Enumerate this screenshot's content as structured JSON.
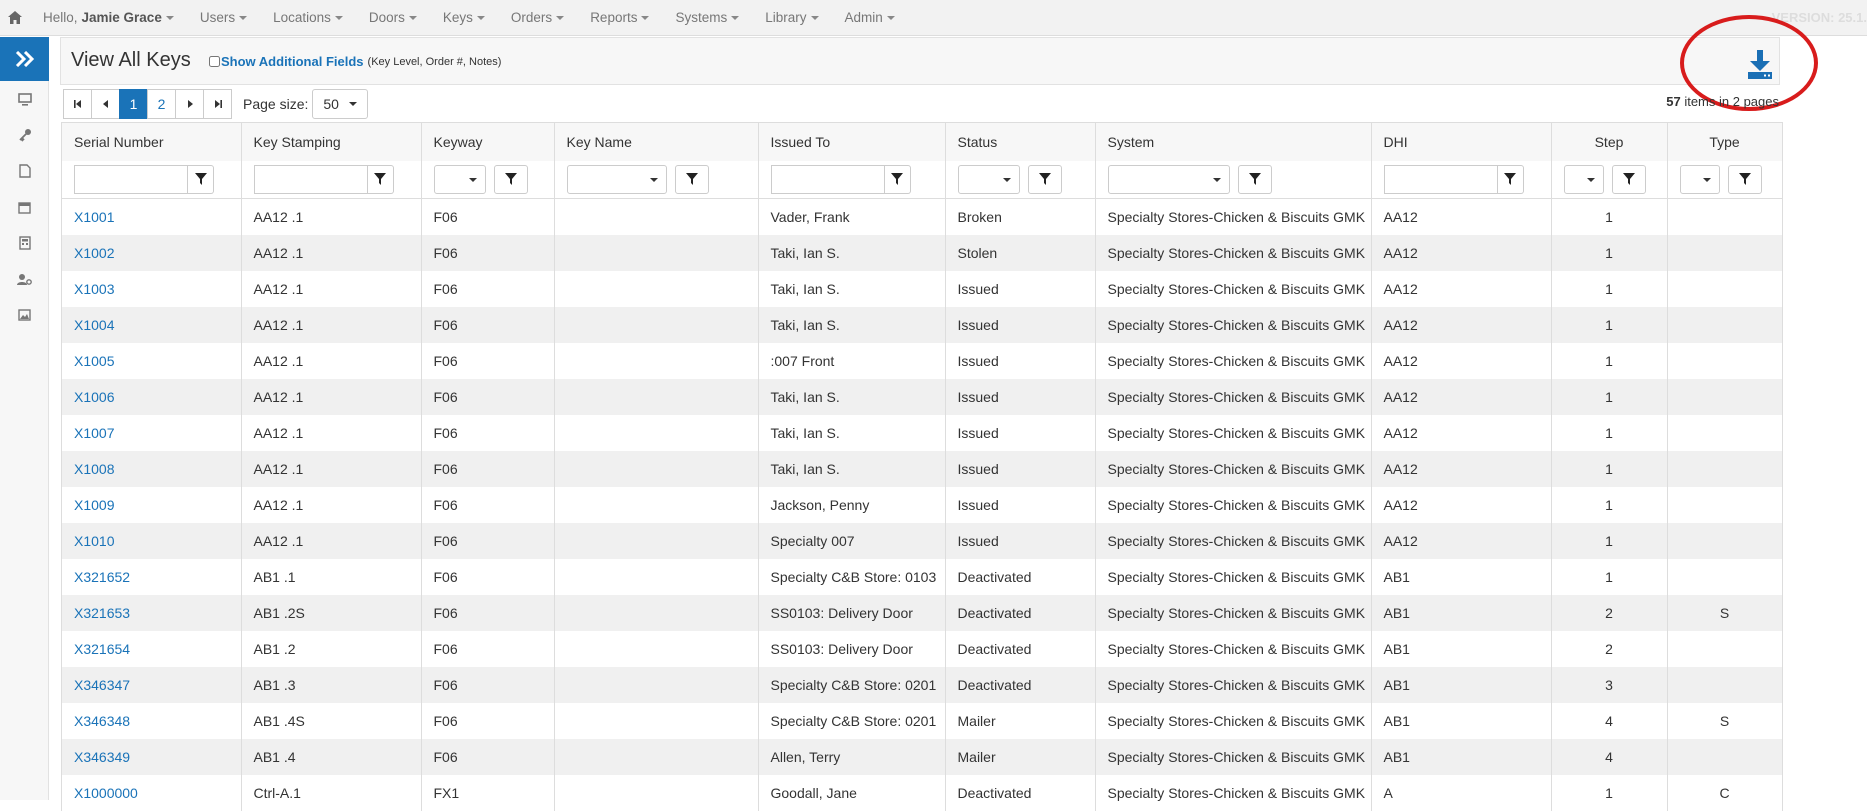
{
  "nav": {
    "greeting": "Hello,",
    "user": "Jamie Grace",
    "items": [
      "Users",
      "Locations",
      "Doors",
      "Keys",
      "Orders",
      "Reports",
      "Systems",
      "Library",
      "Admin"
    ],
    "version": "VERSION: 25.1."
  },
  "page": {
    "title": "View All Keys",
    "show_fields_label": "Show Additional Fields",
    "show_fields_hint": "(Key Level, Order #, Notes)"
  },
  "pager": {
    "pages": [
      "1",
      "2"
    ],
    "page_size_label": "Page size:",
    "page_size": "50",
    "items_count": "57",
    "items_text": "items in 2 pages"
  },
  "columns": [
    "Serial Number",
    "Key Stamping",
    "Keyway",
    "Key Name",
    "Issued To",
    "Status",
    "System",
    "DHI",
    "Step",
    "Type"
  ],
  "rows": [
    [
      "X1001",
      "AA12 .1",
      "F06",
      "",
      "Vader, Frank",
      "Broken",
      "Specialty Stores-Chicken & Biscuits GMK",
      "AA12",
      "1",
      ""
    ],
    [
      "X1002",
      "AA12 .1",
      "F06",
      "",
      "Taki, Ian S.",
      "Stolen",
      "Specialty Stores-Chicken & Biscuits GMK",
      "AA12",
      "1",
      ""
    ],
    [
      "X1003",
      "AA12 .1",
      "F06",
      "",
      "Taki, Ian S.",
      "Issued",
      "Specialty Stores-Chicken & Biscuits GMK",
      "AA12",
      "1",
      ""
    ],
    [
      "X1004",
      "AA12 .1",
      "F06",
      "",
      "Taki, Ian S.",
      "Issued",
      "Specialty Stores-Chicken & Biscuits GMK",
      "AA12",
      "1",
      ""
    ],
    [
      "X1005",
      "AA12 .1",
      "F06",
      "",
      ":007 Front",
      "Issued",
      "Specialty Stores-Chicken & Biscuits GMK",
      "AA12",
      "1",
      ""
    ],
    [
      "X1006",
      "AA12 .1",
      "F06",
      "",
      "Taki, Ian S.",
      "Issued",
      "Specialty Stores-Chicken & Biscuits GMK",
      "AA12",
      "1",
      ""
    ],
    [
      "X1007",
      "AA12 .1",
      "F06",
      "",
      "Taki, Ian S.",
      "Issued",
      "Specialty Stores-Chicken & Biscuits GMK",
      "AA12",
      "1",
      ""
    ],
    [
      "X1008",
      "AA12 .1",
      "F06",
      "",
      "Taki, Ian S.",
      "Issued",
      "Specialty Stores-Chicken & Biscuits GMK",
      "AA12",
      "1",
      ""
    ],
    [
      "X1009",
      "AA12 .1",
      "F06",
      "",
      "Jackson, Penny",
      "Issued",
      "Specialty Stores-Chicken & Biscuits GMK",
      "AA12",
      "1",
      ""
    ],
    [
      "X1010",
      "AA12 .1",
      "F06",
      "",
      "Specialty 007",
      "Issued",
      "Specialty Stores-Chicken & Biscuits GMK",
      "AA12",
      "1",
      ""
    ],
    [
      "X321652",
      "AB1 .1",
      "F06",
      "",
      "Specialty C&B Store: 0103",
      "Deactivated",
      "Specialty Stores-Chicken & Biscuits GMK",
      "AB1",
      "1",
      ""
    ],
    [
      "X321653",
      "AB1 .2S",
      "F06",
      "",
      "SS0103: Delivery Door",
      "Deactivated",
      "Specialty Stores-Chicken & Biscuits GMK",
      "AB1",
      "2",
      "S"
    ],
    [
      "X321654",
      "AB1 .2",
      "F06",
      "",
      "SS0103: Delivery Door",
      "Deactivated",
      "Specialty Stores-Chicken & Biscuits GMK",
      "AB1",
      "2",
      ""
    ],
    [
      "X346347",
      "AB1 .3",
      "F06",
      "",
      "Specialty C&B Store: 0201",
      "Deactivated",
      "Specialty Stores-Chicken & Biscuits GMK",
      "AB1",
      "3",
      ""
    ],
    [
      "X346348",
      "AB1 .4S",
      "F06",
      "",
      "Specialty C&B Store: 0201",
      "Mailer",
      "Specialty Stores-Chicken & Biscuits GMK",
      "AB1",
      "4",
      "S"
    ],
    [
      "X346349",
      "AB1 .4",
      "F06",
      "",
      "Allen, Terry",
      "Mailer",
      "Specialty Stores-Chicken & Biscuits GMK",
      "AB1",
      "4",
      ""
    ],
    [
      "X1000000",
      "Ctrl-A.1",
      "FX1",
      "",
      "Goodall, Jane",
      "Deactivated",
      "Specialty Stores-Chicken & Biscuits GMK",
      "A",
      "1",
      "C"
    ]
  ],
  "colors": {
    "accent": "#1a73b8",
    "highlight_circle": "#d81c1c"
  }
}
